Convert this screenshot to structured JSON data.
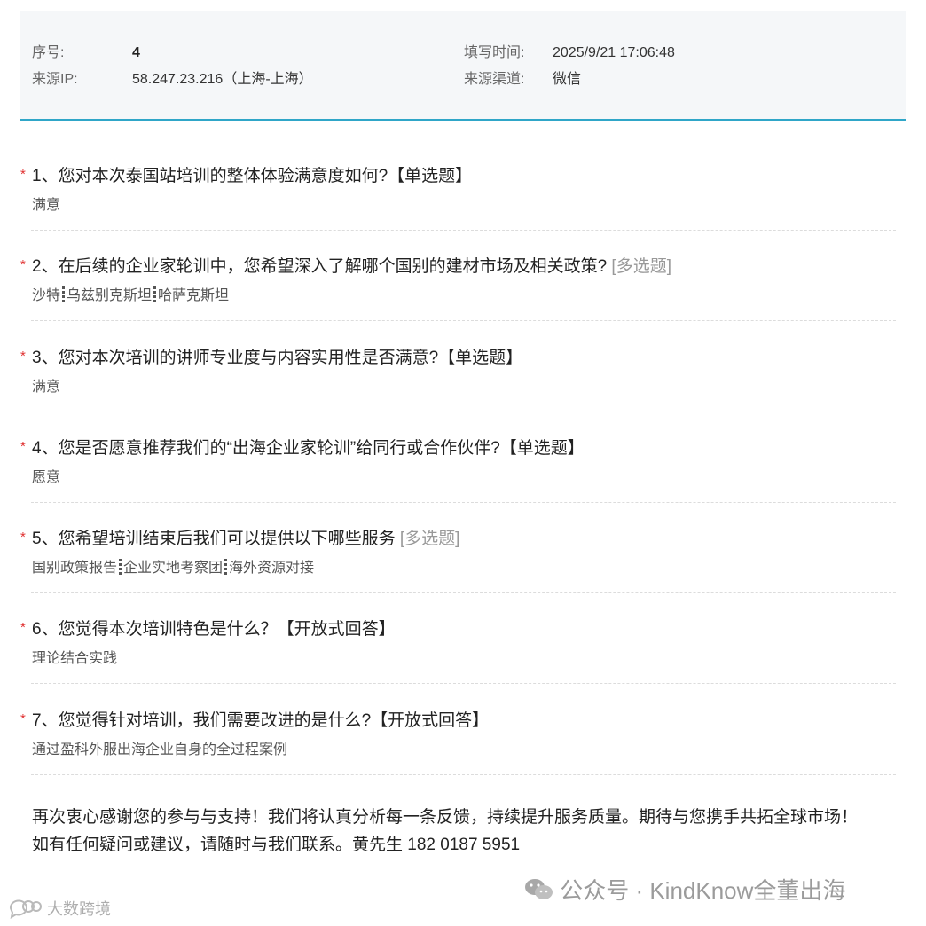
{
  "info": {
    "serial_label": "序号:",
    "serial_value": "4",
    "fill_time_label": "填写时间:",
    "fill_time_value": "2025/9/21 17:06:48",
    "source_ip_label": "来源IP:",
    "source_ip_value": "58.247.23.216（上海-上海）",
    "source_channel_label": "来源渠道:",
    "source_channel_value": "微信"
  },
  "questions": [
    {
      "title": "1、您对本次泰国站培训的整体体验满意度如何?【单选题】",
      "answer": "满意"
    },
    {
      "title": "2、在后续的企业家轮训中，您希望深入了解哪个国别的建材市场及相关政策?",
      "tag": "[多选题]",
      "answers": [
        "沙特",
        "乌兹别克斯坦",
        "哈萨克斯坦"
      ]
    },
    {
      "title": "3、您对本次培训的讲师专业度与内容实用性是否满意?【单选题】",
      "answer": "满意"
    },
    {
      "title": "4、您是否愿意推荐我们的“出海企业家轮训”给同行或合作伙伴?【单选题】",
      "answer": "愿意"
    },
    {
      "title": "5、您希望培训结束后我们可以提供以下哪些服务",
      "tag": "[多选题]",
      "answers": [
        "国别政策报告",
        "企业实地考察团",
        "海外资源对接"
      ]
    },
    {
      "title": "6、您觉得本次培训特色是什么？【开放式回答】",
      "answer": "理论结合实践"
    },
    {
      "title": "7、您觉得针对培训，我们需要改进的是什么?【开放式回答】",
      "answer": "通过盈科外服出海企业自身的全过程案例"
    }
  ],
  "closing": {
    "line1": "再次衷心感谢您的参与与支持！我们将认真分析每一条反馈，持续提升服务质量。期待与您携手共拓全球市场！",
    "line2": "如有任何疑问或建议，请随时与我们联系。黄先生 182 0187 5951"
  },
  "required_mark": "*",
  "watermarks": {
    "right": "公众号 · KindKnow全董出海",
    "left": "大数跨境"
  },
  "colors": {
    "accent": "#2fa6c8",
    "required": "#e03030"
  }
}
